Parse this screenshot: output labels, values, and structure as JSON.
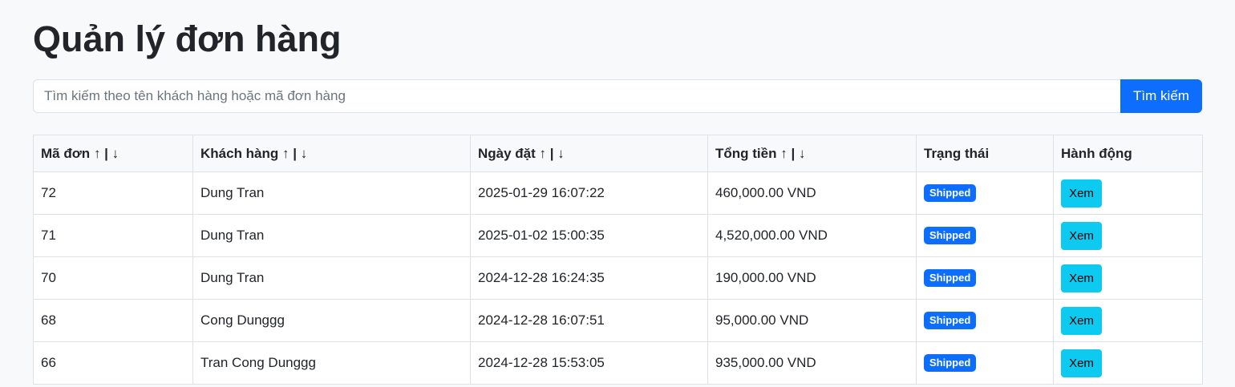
{
  "page": {
    "title": "Quản lý đơn hàng"
  },
  "search": {
    "placeholder": "Tìm kiếm theo tên khách hàng hoặc mã đơn hàng",
    "button_label": "Tìm kiếm"
  },
  "table": {
    "sort_up": "↑",
    "sort_sep": "|",
    "sort_down": "↓",
    "headers": {
      "order_id": "Mã đơn",
      "customer": "Khách hàng",
      "order_date": "Ngày đặt",
      "total": "Tổng tiền",
      "status": "Trạng thái",
      "action": "Hành động"
    },
    "rows": [
      {
        "order_id": "72",
        "customer": "Dung Tran",
        "order_date": "2025-01-29 16:07:22",
        "total": "460,000.00 VND",
        "status": "Shipped",
        "action": "Xem"
      },
      {
        "order_id": "71",
        "customer": "Dung Tran",
        "order_date": "2025-01-02 15:00:35",
        "total": "4,520,000.00 VND",
        "status": "Shipped",
        "action": "Xem"
      },
      {
        "order_id": "70",
        "customer": "Dung Tran",
        "order_date": "2024-12-28 16:24:35",
        "total": "190,000.00 VND",
        "status": "Shipped",
        "action": "Xem"
      },
      {
        "order_id": "68",
        "customer": "Cong Dunggg",
        "order_date": "2024-12-28 16:07:51",
        "total": "95,000.00 VND",
        "status": "Shipped",
        "action": "Xem"
      },
      {
        "order_id": "66",
        "customer": "Tran Cong Dunggg",
        "order_date": "2024-12-28 15:53:05",
        "total": "935,000.00 VND",
        "status": "Shipped",
        "action": "Xem"
      }
    ]
  },
  "colors": {
    "primary": "#0d6efd",
    "info": "#0dcaf0",
    "background": "#f8f9fa",
    "text": "#212529"
  }
}
